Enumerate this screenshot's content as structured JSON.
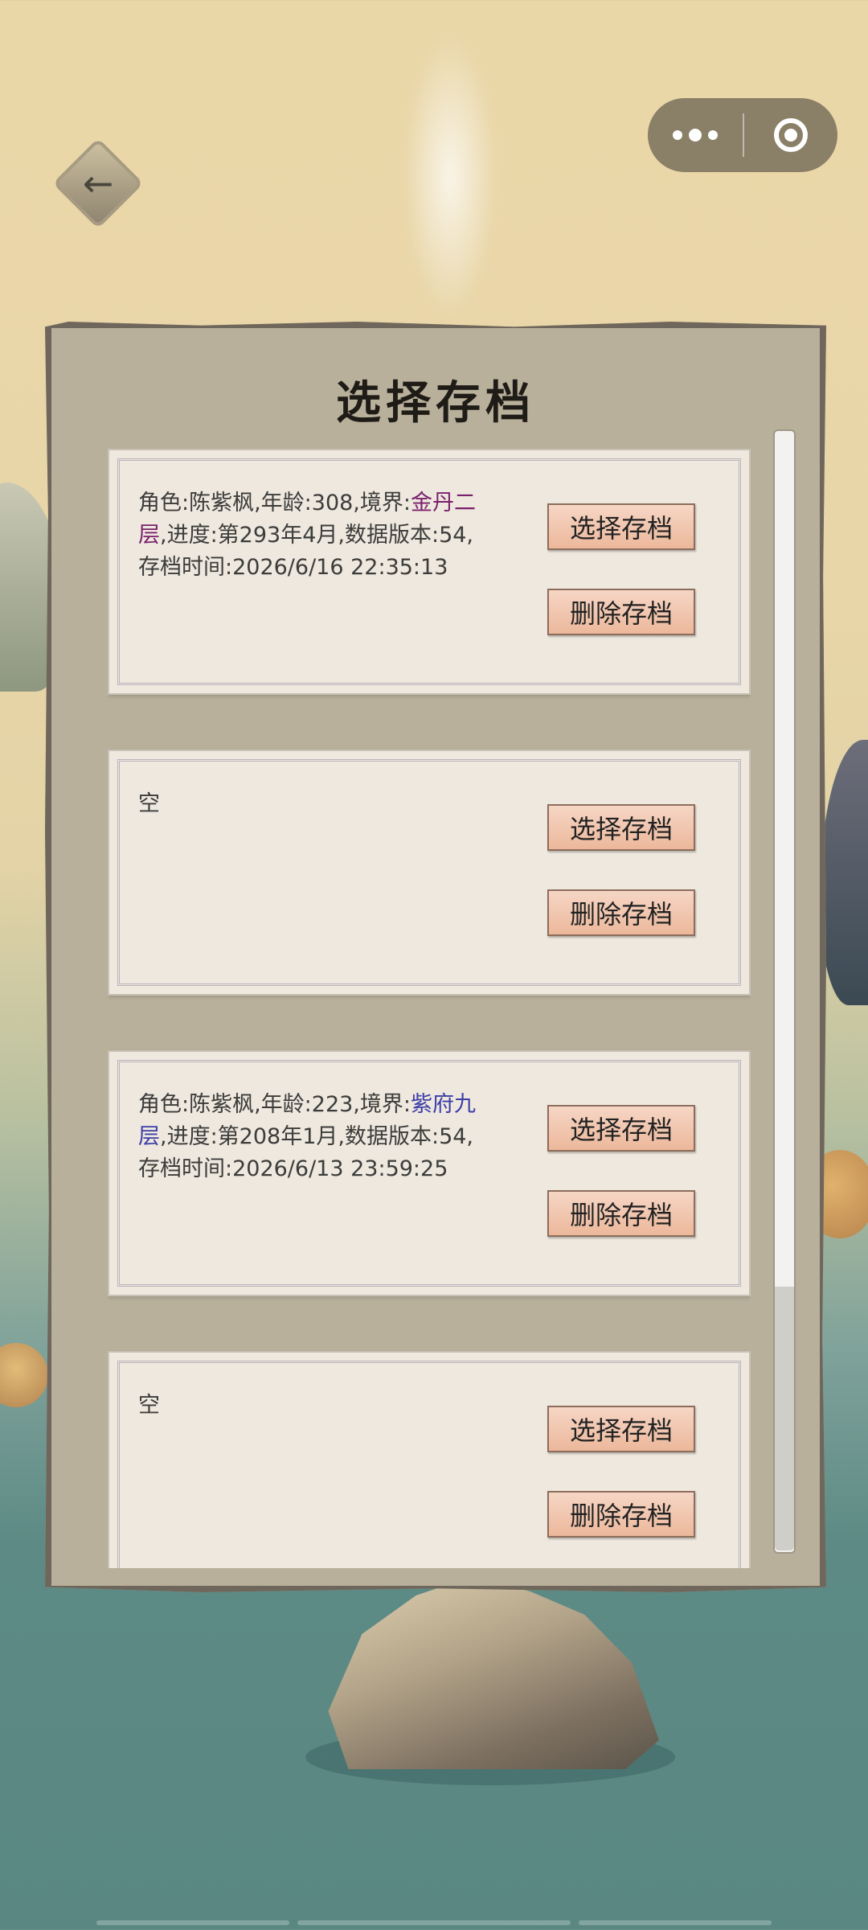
{
  "header": {
    "back_icon": "back-arrow-icon",
    "capsule": {
      "more_icon": "more-dots-icon",
      "close_icon": "target-circle-icon"
    }
  },
  "panel": {
    "title": "选择存档",
    "slots": [
      {
        "prefix": "角色:陈紫枫,年龄:308,境界:",
        "realm": "金丹二层",
        "suffix": ",进度:第293年4月,数据版本:54,存档时间:2026/6/16 22:35:13",
        "select_label": "选择存档",
        "delete_label": "删除存档"
      },
      {
        "prefix": "空",
        "realm": "",
        "suffix": "",
        "select_label": "选择存档",
        "delete_label": "删除存档"
      },
      {
        "prefix": "角色:陈紫枫,年龄:223,境界:",
        "realm": "紫府九层",
        "suffix": ",进度:第208年1月,数据版本:54,存档时间:2026/6/13 23:59:25",
        "select_label": "选择存档",
        "delete_label": "删除存档"
      },
      {
        "prefix": "空",
        "realm": "",
        "suffix": "",
        "select_label": "选择存档",
        "delete_label": "删除存档"
      }
    ]
  },
  "colors": {
    "realm_jindan": "#7a1f6b",
    "realm_zifu": "#3c3ea8",
    "button_fill": "#ecb89b"
  }
}
